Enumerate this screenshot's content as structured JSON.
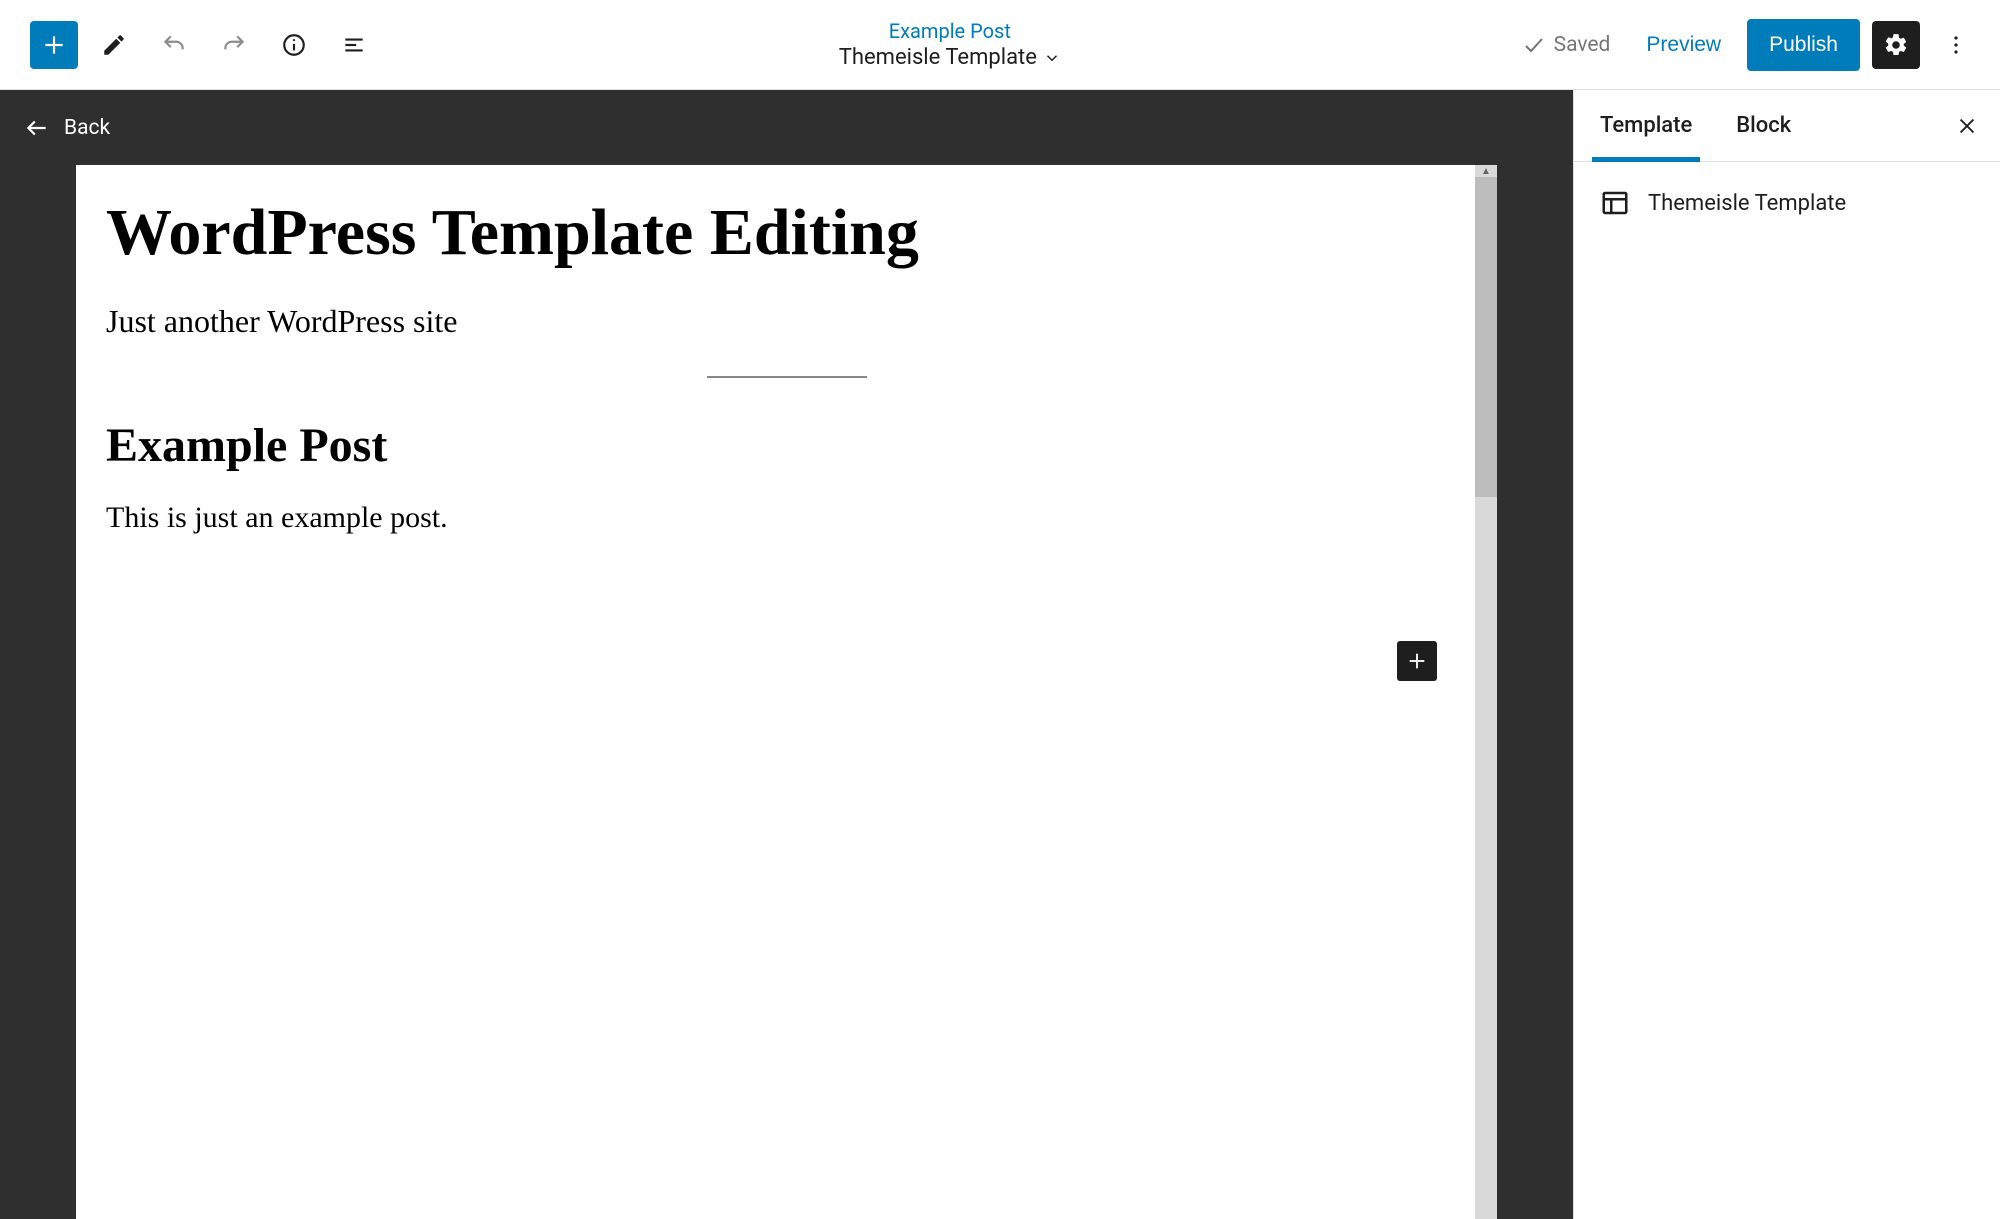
{
  "toolbar": {
    "post_link": "Example Post",
    "template_name": "Themeisle Template",
    "saved_label": "Saved",
    "preview_label": "Preview",
    "publish_label": "Publish"
  },
  "nav": {
    "back_label": "Back"
  },
  "canvas": {
    "site_title": "WordPress Template Editing",
    "site_tagline": "Just another WordPress site",
    "post_title": "Example Post",
    "post_body": "This is just an example post."
  },
  "sidebar": {
    "tabs": {
      "template": "Template",
      "block": "Block"
    },
    "template_item_label": "Themeisle Template"
  }
}
